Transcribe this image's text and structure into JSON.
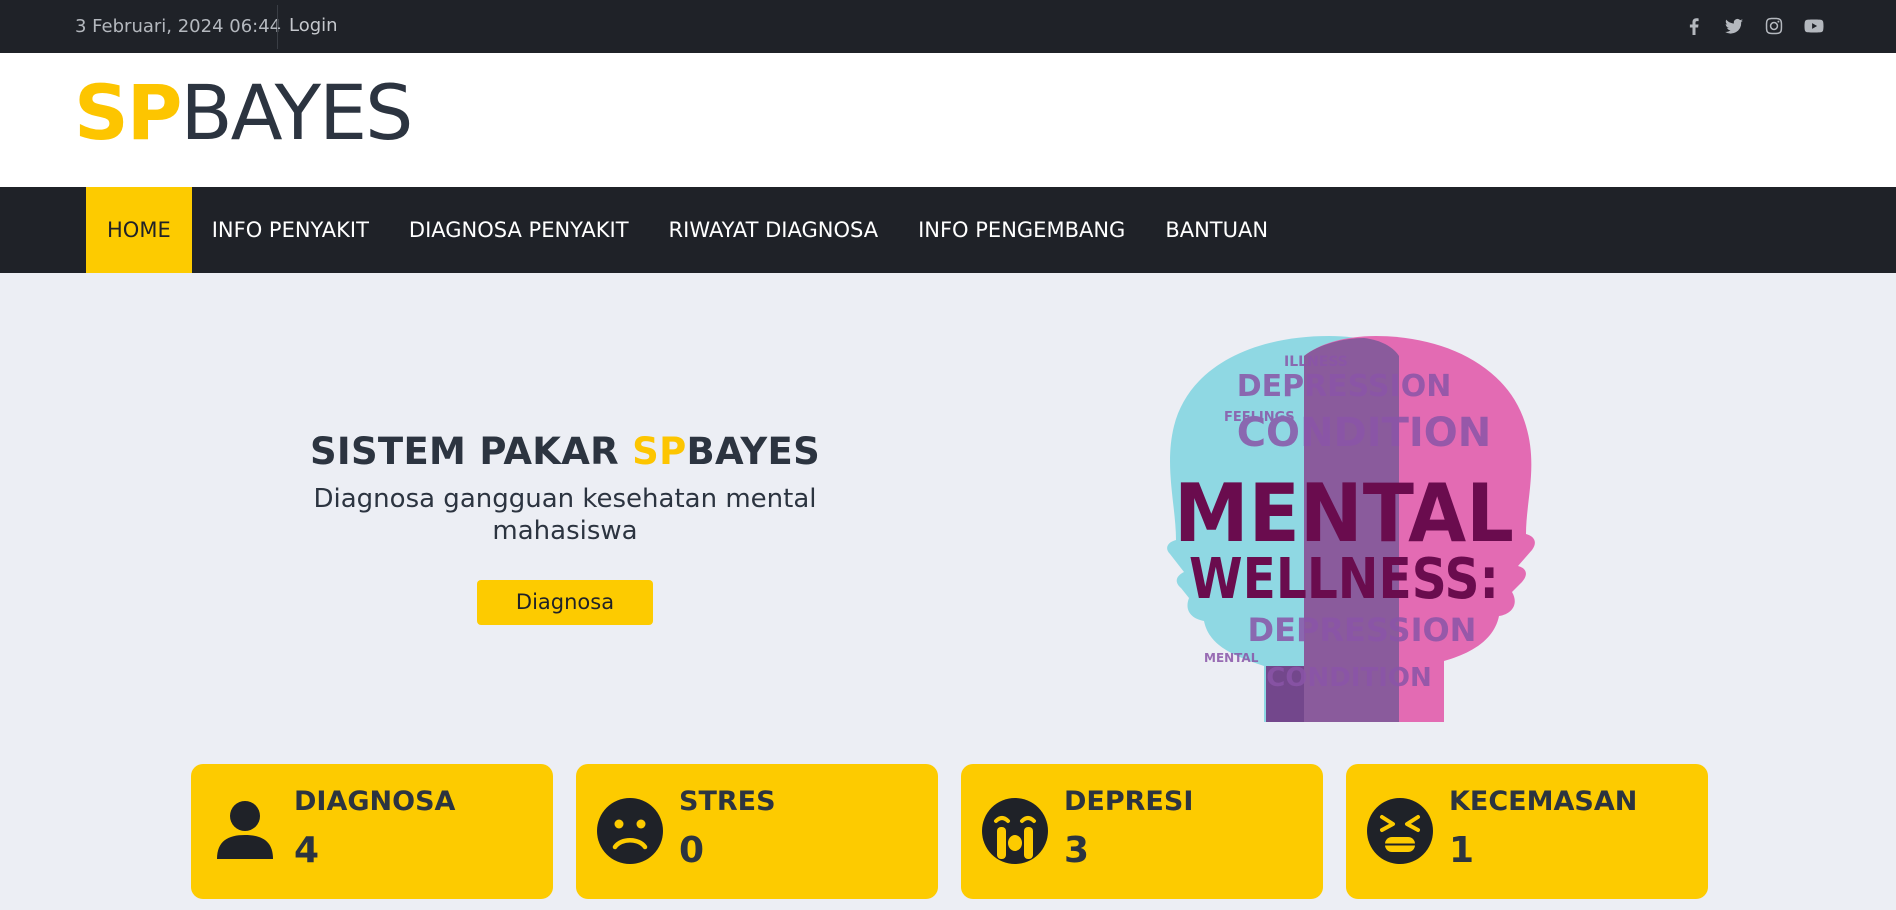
{
  "topbar": {
    "date": "3 Februari, 2024 06:44",
    "login": "Login",
    "social": [
      "facebook-icon",
      "twitter-icon",
      "instagram-icon",
      "youtube-icon"
    ]
  },
  "brand": {
    "sp": "SP",
    "bayes": "BAYES"
  },
  "nav": {
    "items": [
      "HOME",
      "INFO PENYAKIT",
      "DIAGNOSA PENYAKIT",
      "RIWAYAT DIAGNOSA",
      "INFO PENGEMBANG",
      "BANTUAN"
    ],
    "active": "HOME"
  },
  "hero": {
    "title_prefix": "SISTEM PAKAR ",
    "title_sp": "SP",
    "title_suffix": "BAYES",
    "subtitle": "Diagnosa gangguan kesehatan mental mahasiswa",
    "button": "Diagnosa"
  },
  "illustration": {
    "words": [
      "MENTAL",
      "WELLNESS:",
      "DEPRESSION",
      "CONDITION",
      "DEPRESSION",
      "CONDITION",
      "ILLNESS",
      "FEELINGS",
      "MENTAL"
    ]
  },
  "stats": [
    {
      "title": "DIAGNOSA",
      "value": "4",
      "icon": "user-icon"
    },
    {
      "title": "STRES",
      "value": "0",
      "icon": "sad-face-icon"
    },
    {
      "title": "DEPRESI",
      "value": "3",
      "icon": "crying-face-icon"
    },
    {
      "title": "KECEMASAN",
      "value": "1",
      "icon": "anxious-face-icon"
    }
  ],
  "colors": {
    "accent": "#fdcb00",
    "dark": "#1f2228",
    "text": "#2c3440",
    "background": "#eceef4"
  }
}
